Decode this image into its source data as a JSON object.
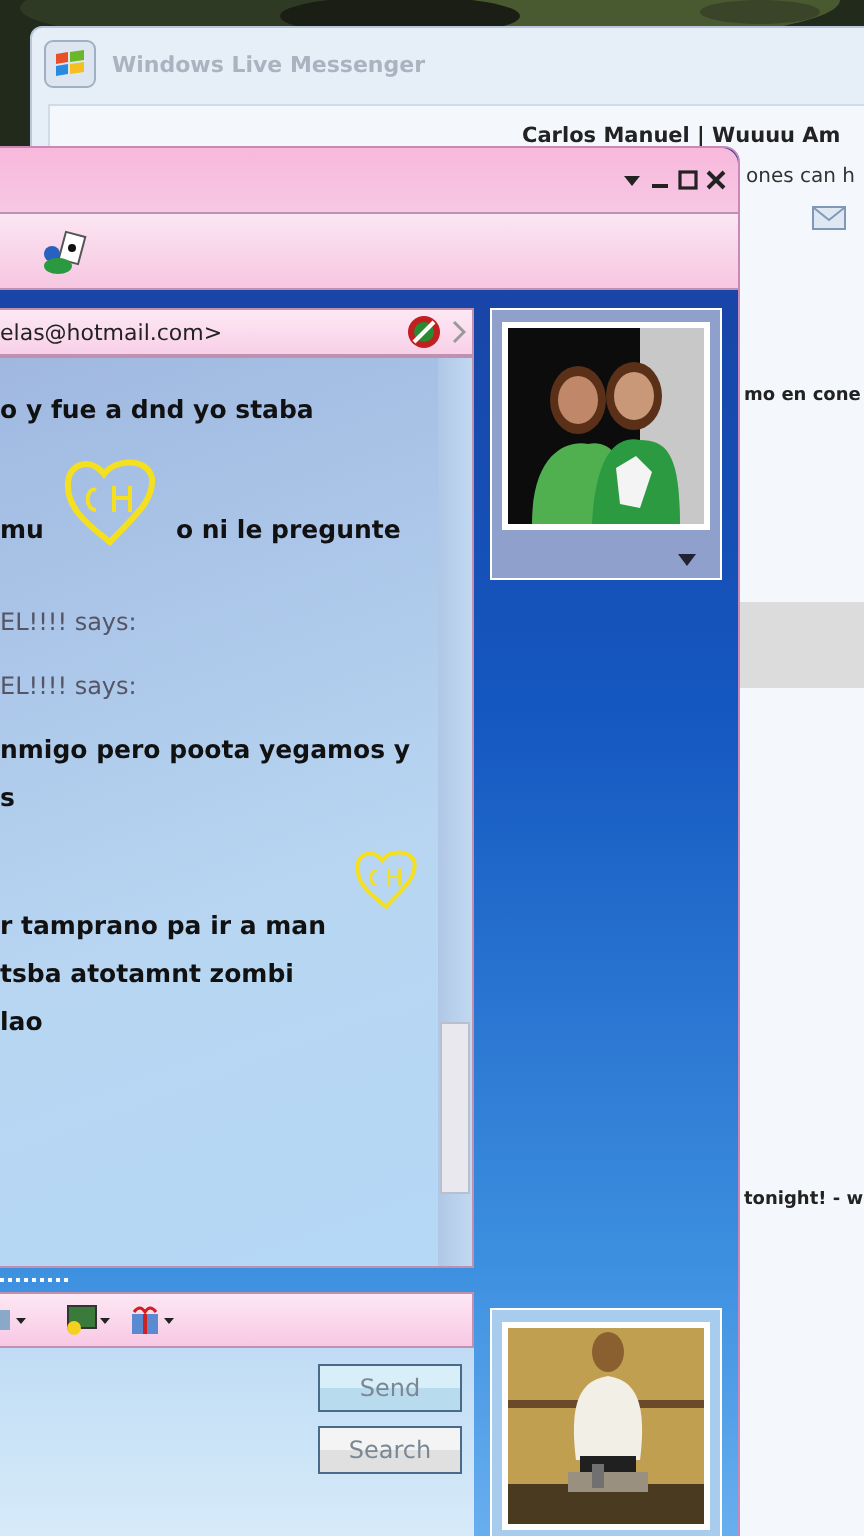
{
  "back_window": {
    "title": "Windows Live Messenger",
    "header_name": "Carlos Manuel | Wuuuu Am",
    "header_message": "ones can h",
    "list_texts": [
      "mo en cone",
      "tonight! - w"
    ]
  },
  "chat_window": {
    "contact_address": "elas@hotmail.com>",
    "messages": [
      {
        "kind": "text",
        "text": "o y fue a dnd yo staba"
      },
      {
        "kind": "emoticon_line",
        "before": "mu",
        "after": "o ni le pregunte"
      },
      {
        "kind": "says",
        "text": "EL!!!! says:"
      },
      {
        "kind": "says",
        "text": "EL!!!! says:"
      },
      {
        "kind": "text",
        "text": "nmigo pero poota yegamos y"
      },
      {
        "kind": "text",
        "text": "s"
      },
      {
        "kind": "emoticon"
      },
      {
        "kind": "text",
        "text": "r tamprano pa ir a man"
      },
      {
        "kind": "text",
        "text": "tsba atotamnt zombi"
      },
      {
        "kind": "text",
        "text": "lao"
      }
    ],
    "buttons": [
      {
        "label": "Send",
        "kind": "send",
        "disabled": true
      },
      {
        "label": "Search",
        "kind": "search",
        "disabled": true
      }
    ]
  }
}
